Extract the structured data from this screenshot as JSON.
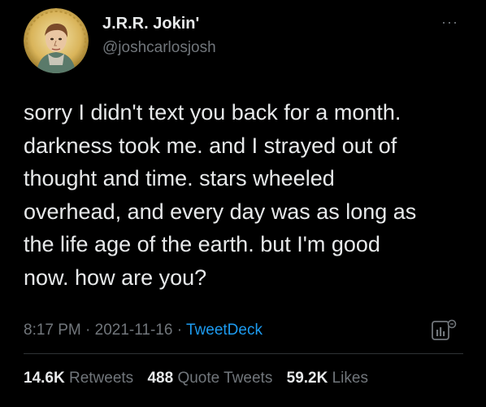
{
  "author": {
    "display_name": "J.R.R. Jokin'",
    "handle": "@joshcarlosjosh"
  },
  "more_menu": "···",
  "tweet": {
    "text": "sorry I didn't text you back for a month.\ndarkness took me. and I strayed out of\nthought and time. stars wheeled\noverhead, and every day was as long as\nthe life age of the earth. but I'm good\nnow. how are you?"
  },
  "meta": {
    "time": "8:17 PM",
    "date": "2021-11-16",
    "separator": " · ",
    "source": "TweetDeck"
  },
  "stats": {
    "retweets_count": "14.6K",
    "retweets_label": "Retweets",
    "quotes_count": "488",
    "quotes_label": "Quote Tweets",
    "likes_count": "59.2K",
    "likes_label": "Likes"
  },
  "colors": {
    "background": "#000000",
    "text": "#e7e9ea",
    "secondary": "#71767b",
    "link": "#1d9bf0"
  },
  "icons": {
    "avatar": "avatar-portrait-icon",
    "analytics": "analytics-icon"
  }
}
